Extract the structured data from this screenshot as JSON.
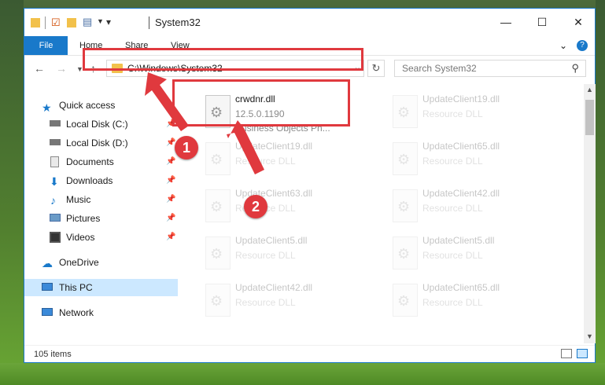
{
  "window": {
    "title": "System32"
  },
  "window_controls": {
    "minimize": "—",
    "maximize": "☐",
    "close": "✕"
  },
  "ribbon": {
    "file": "File",
    "tabs": [
      "Home",
      "Share",
      "View"
    ],
    "help": "?"
  },
  "address": {
    "path": "C:\\Windows\\System32"
  },
  "search": {
    "placeholder": "Search System32"
  },
  "nav": {
    "quick_access": "Quick access",
    "items": [
      {
        "label": "Local Disk (C:)",
        "icon": "drive-icon"
      },
      {
        "label": "Local Disk (D:)",
        "icon": "drive-icon"
      },
      {
        "label": "Documents",
        "icon": "documents-icon"
      },
      {
        "label": "Downloads",
        "icon": "downloads-icon"
      },
      {
        "label": "Music",
        "icon": "music-icon"
      },
      {
        "label": "Pictures",
        "icon": "pictures-icon"
      },
      {
        "label": "Videos",
        "icon": "videos-icon"
      }
    ],
    "onedrive": "OneDrive",
    "this_pc": "This PC",
    "network": "Network"
  },
  "files": [
    {
      "name": "crwdnr.dll",
      "line2": "12.5.0.1190",
      "line3": "Business Objects Ph...",
      "highlighted": true
    },
    {
      "name": "UpdateClient19.dll",
      "line2": "Resource DLL"
    },
    {
      "name": "UpdateClient19.dll",
      "line2": "Resource DLL"
    },
    {
      "name": "UpdateClient65.dll",
      "line2": "Resource DLL"
    },
    {
      "name": "UpdateClient63.dll",
      "line2": "Resource DLL"
    },
    {
      "name": "UpdateClient42.dll",
      "line2": "Resource DLL"
    },
    {
      "name": "UpdateClient5.dll",
      "line2": "Resource DLL"
    },
    {
      "name": "UpdateClient5.dll",
      "line2": "Resource DLL"
    },
    {
      "name": "UpdateClient42.dll",
      "line2": "Resource DLL"
    },
    {
      "name": "UpdateClient65.dll",
      "line2": "Resource DLL"
    }
  ],
  "status": {
    "count": "105 items"
  },
  "markers": [
    "1",
    "2"
  ],
  "colors": {
    "accent": "#1979ca",
    "highlight": "#e0393e",
    "selection": "#cce8ff"
  }
}
